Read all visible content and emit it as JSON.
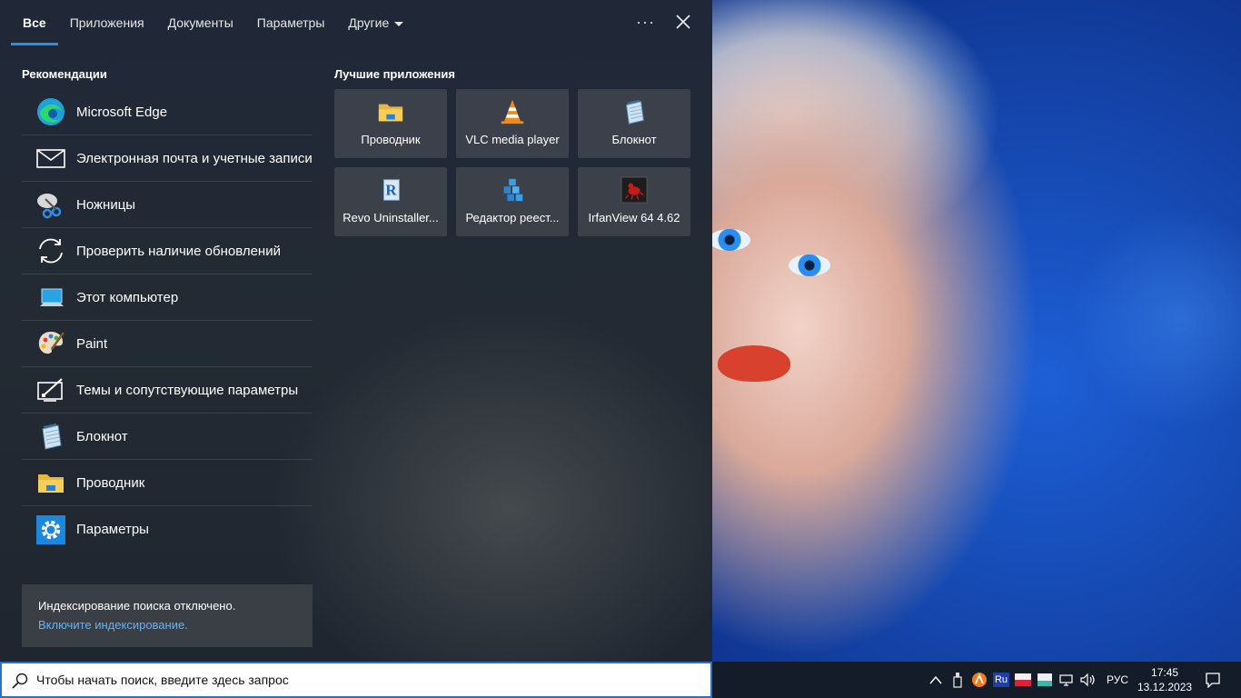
{
  "tabs": {
    "all": "Все",
    "apps": "Приложения",
    "documents": "Документы",
    "settings": "Параметры",
    "more": "Другие"
  },
  "recommendations": {
    "title": "Рекомендации",
    "items": [
      {
        "label": "Microsoft Edge",
        "icon": "edge-icon"
      },
      {
        "label": "Электронная почта и учетные записи",
        "icon": "mail-icon"
      },
      {
        "label": "Ножницы",
        "icon": "scissors-icon"
      },
      {
        "label": "Проверить наличие обновлений",
        "icon": "refresh-icon"
      },
      {
        "label": "Этот компьютер",
        "icon": "computer-icon"
      },
      {
        "label": "Paint",
        "icon": "paint-palette-icon"
      },
      {
        "label": "Темы и сопутствующие параметры",
        "icon": "themes-icon"
      },
      {
        "label": "Блокнот",
        "icon": "notepad-icon"
      },
      {
        "label": "Проводник",
        "icon": "folder-icon"
      },
      {
        "label": "Параметры",
        "icon": "gear-icon"
      }
    ]
  },
  "top_apps": {
    "title": "Лучшие приложения",
    "items": [
      {
        "label": "Проводник",
        "icon": "folder-icon"
      },
      {
        "label": "VLC media player",
        "icon": "vlc-cone-icon"
      },
      {
        "label": "Блокнот",
        "icon": "notepad-icon"
      },
      {
        "label": "Revo Uninstaller...",
        "icon": "revo-uninstaller-icon"
      },
      {
        "label": "Редактор реест...",
        "icon": "registry-editor-icon"
      },
      {
        "label": "IrfanView 64 4.62",
        "icon": "irfanview-icon"
      }
    ]
  },
  "notice": {
    "text": "Индексирование поиска отключено.",
    "link": "Включите индексирование."
  },
  "search": {
    "placeholder": "Чтобы начать поиск, введите здесь запрос"
  },
  "tray": {
    "language": "РУС",
    "lang_badge": "Ru",
    "time": "17:45",
    "date": "13.12.2023"
  },
  "colors": {
    "accent": "#2e8fe0",
    "link": "#63b2f5",
    "panel_bg": "#222a34",
    "taskbar_bg": "#141c2a"
  }
}
